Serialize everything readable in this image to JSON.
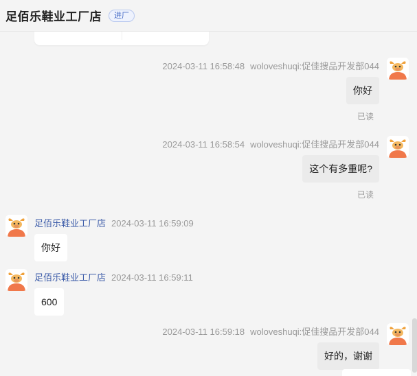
{
  "header": {
    "shop_name": "足佰乐鞋业工厂店",
    "enter_label": "进厂"
  },
  "messages": [
    {
      "side": "right",
      "timestamp": "2024-03-11 16:58:48",
      "sender": "woloveshuqi:促佳搜品开发部044",
      "text": "你好",
      "status": "已读"
    },
    {
      "side": "right",
      "timestamp": "2024-03-11 16:58:54",
      "sender": "woloveshuqi:促佳搜品开发部044",
      "text": "这个有多重呢?",
      "status": "已读"
    },
    {
      "side": "left",
      "sender": "足佰乐鞋业工厂店",
      "timestamp": "2024-03-11 16:59:09",
      "text": "你好"
    },
    {
      "side": "left",
      "sender": "足佰乐鞋业工厂店",
      "timestamp": "2024-03-11 16:59:11",
      "text": "600"
    },
    {
      "side": "right",
      "timestamp": "2024-03-11 16:59:18",
      "sender": "woloveshuqi:促佳搜品开发部044",
      "text": "好的，谢谢"
    }
  ],
  "colors": {
    "background": "#f4f4f4",
    "outgoing_bubble": "#ebebeb",
    "incoming_bubble": "#ffffff",
    "shop_name": "#3a5aa8",
    "avatar_accent": "#f0784a"
  },
  "icons": {
    "avatar": "bull-avatar-icon"
  }
}
